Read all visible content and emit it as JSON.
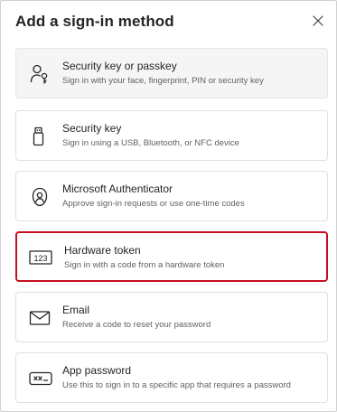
{
  "dialog": {
    "title": "Add a sign-in method",
    "close_icon": "close-icon"
  },
  "methods": [
    {
      "label": "Security key or passkey",
      "description": "Sign in with your face, fingerprint, PIN or security key",
      "icon": "passkey-person-key-icon",
      "state": "hover"
    },
    {
      "label": "Security key",
      "description": "Sign in using a USB, Bluetooth, or NFC device",
      "icon": "usb-key-icon",
      "state": "default"
    },
    {
      "label": "Microsoft Authenticator",
      "description": "Approve sign-in requests or use one-time codes",
      "icon": "authenticator-lock-icon",
      "state": "default"
    },
    {
      "label": "Hardware token",
      "description": "Sign in with a code from a hardware token",
      "icon": "number-123-icon",
      "state": "selected"
    },
    {
      "label": "Email",
      "description": "Receive a code to reset your password",
      "icon": "mail-icon",
      "state": "default"
    },
    {
      "label": "App password",
      "description": "Use this to sign in to a specific app that requires a password",
      "icon": "password-icon",
      "state": "default"
    }
  ],
  "colors": {
    "selected_border": "#c50f1f",
    "hover_background": "#f5f5f5",
    "text_primary": "#242424",
    "text_secondary": "#616161"
  }
}
